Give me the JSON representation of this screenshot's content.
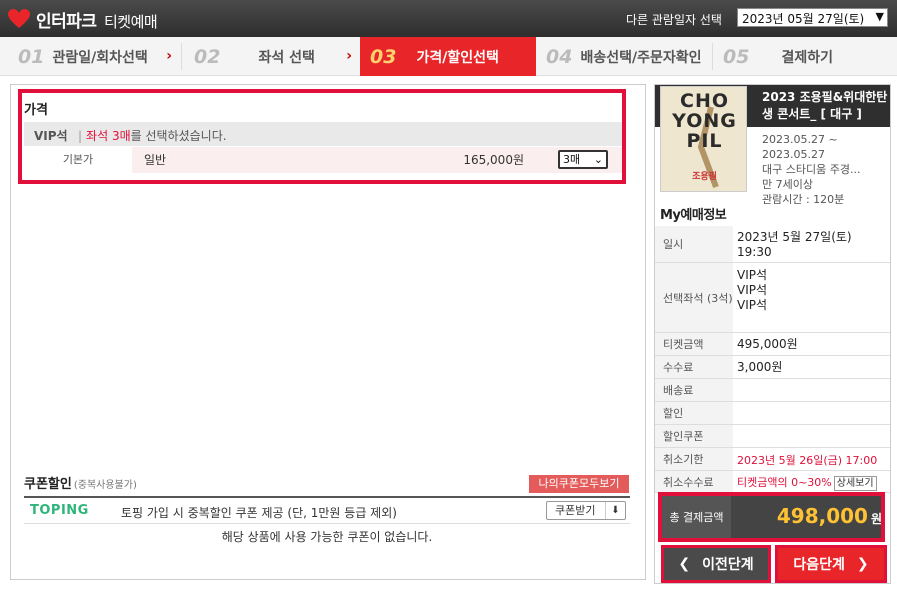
{
  "header": {
    "brand": "인터파크",
    "brand_sub": "티켓예매",
    "other_date_label": "다른 관람일자 선택",
    "selected_date": "2023년 05월 27일(토)"
  },
  "steps": [
    {
      "num": "01",
      "label": "관람일/회차선택"
    },
    {
      "num": "02",
      "label": "좌석 선택"
    },
    {
      "num": "03",
      "label": "가격/할인선택"
    },
    {
      "num": "04",
      "label": "배송선택/주문자확인"
    },
    {
      "num": "05",
      "label": "결제하기"
    }
  ],
  "price": {
    "title": "가격",
    "seat_grade": "VIP석",
    "msg_prefix": "좌석 3매",
    "msg_suffix": "를 선택하셨습니다.",
    "row_label": "기본가",
    "row_type": "일반",
    "row_price": "165,000원",
    "qty": "3매"
  },
  "coupon": {
    "title": "쿠폰할인",
    "title_note": "(중복사용불가)",
    "my_coupon_btn": "나의쿠폰모두보기",
    "provider": "TOPING",
    "desc": "토핑 가입 시 중복할인 쿠폰 제공 (단, 1만원 등급 제외)",
    "get_btn": "쿠폰받기",
    "empty_msg": "해당 상품에 사용 가능한 쿠폰이 없습니다."
  },
  "show": {
    "poster_text": "CHO YONG PIL",
    "poster_sub": "조용필",
    "title": "2023 조용필&위대한탄생 콘서트_ [ 대구 ]",
    "period": "2023.05.27 ~ 2023.05.27",
    "venue": "대구 스타디움 주경...",
    "age": "만 7세이상",
    "runtime": "관람시간 : 120분"
  },
  "my_booking": {
    "title": "My예매정보",
    "rows": [
      {
        "label": "일시",
        "value": "2023년 5월 27일(토) 19:30"
      },
      {
        "label": "선택좌석 (3석)",
        "value": "VIP석\nVIP석\nVIP석"
      },
      {
        "label": "티켓금액",
        "value": "495,000원"
      },
      {
        "label": "수수료",
        "value": "3,000원"
      },
      {
        "label": "배송료",
        "value": ""
      },
      {
        "label": "할인",
        "value": ""
      },
      {
        "label": "할인쿠폰",
        "value": ""
      },
      {
        "label": "취소기한",
        "value": "2023년 5월 26일(금) 17:00"
      },
      {
        "label": "취소수수료",
        "value": "티켓금액의 0~30%"
      }
    ],
    "detail_btn": "상세보기"
  },
  "total": {
    "label": "총 결제금액",
    "value": "498,000",
    "unit": "원"
  },
  "nav": {
    "prev": "이전단계",
    "next": "다음단계"
  }
}
